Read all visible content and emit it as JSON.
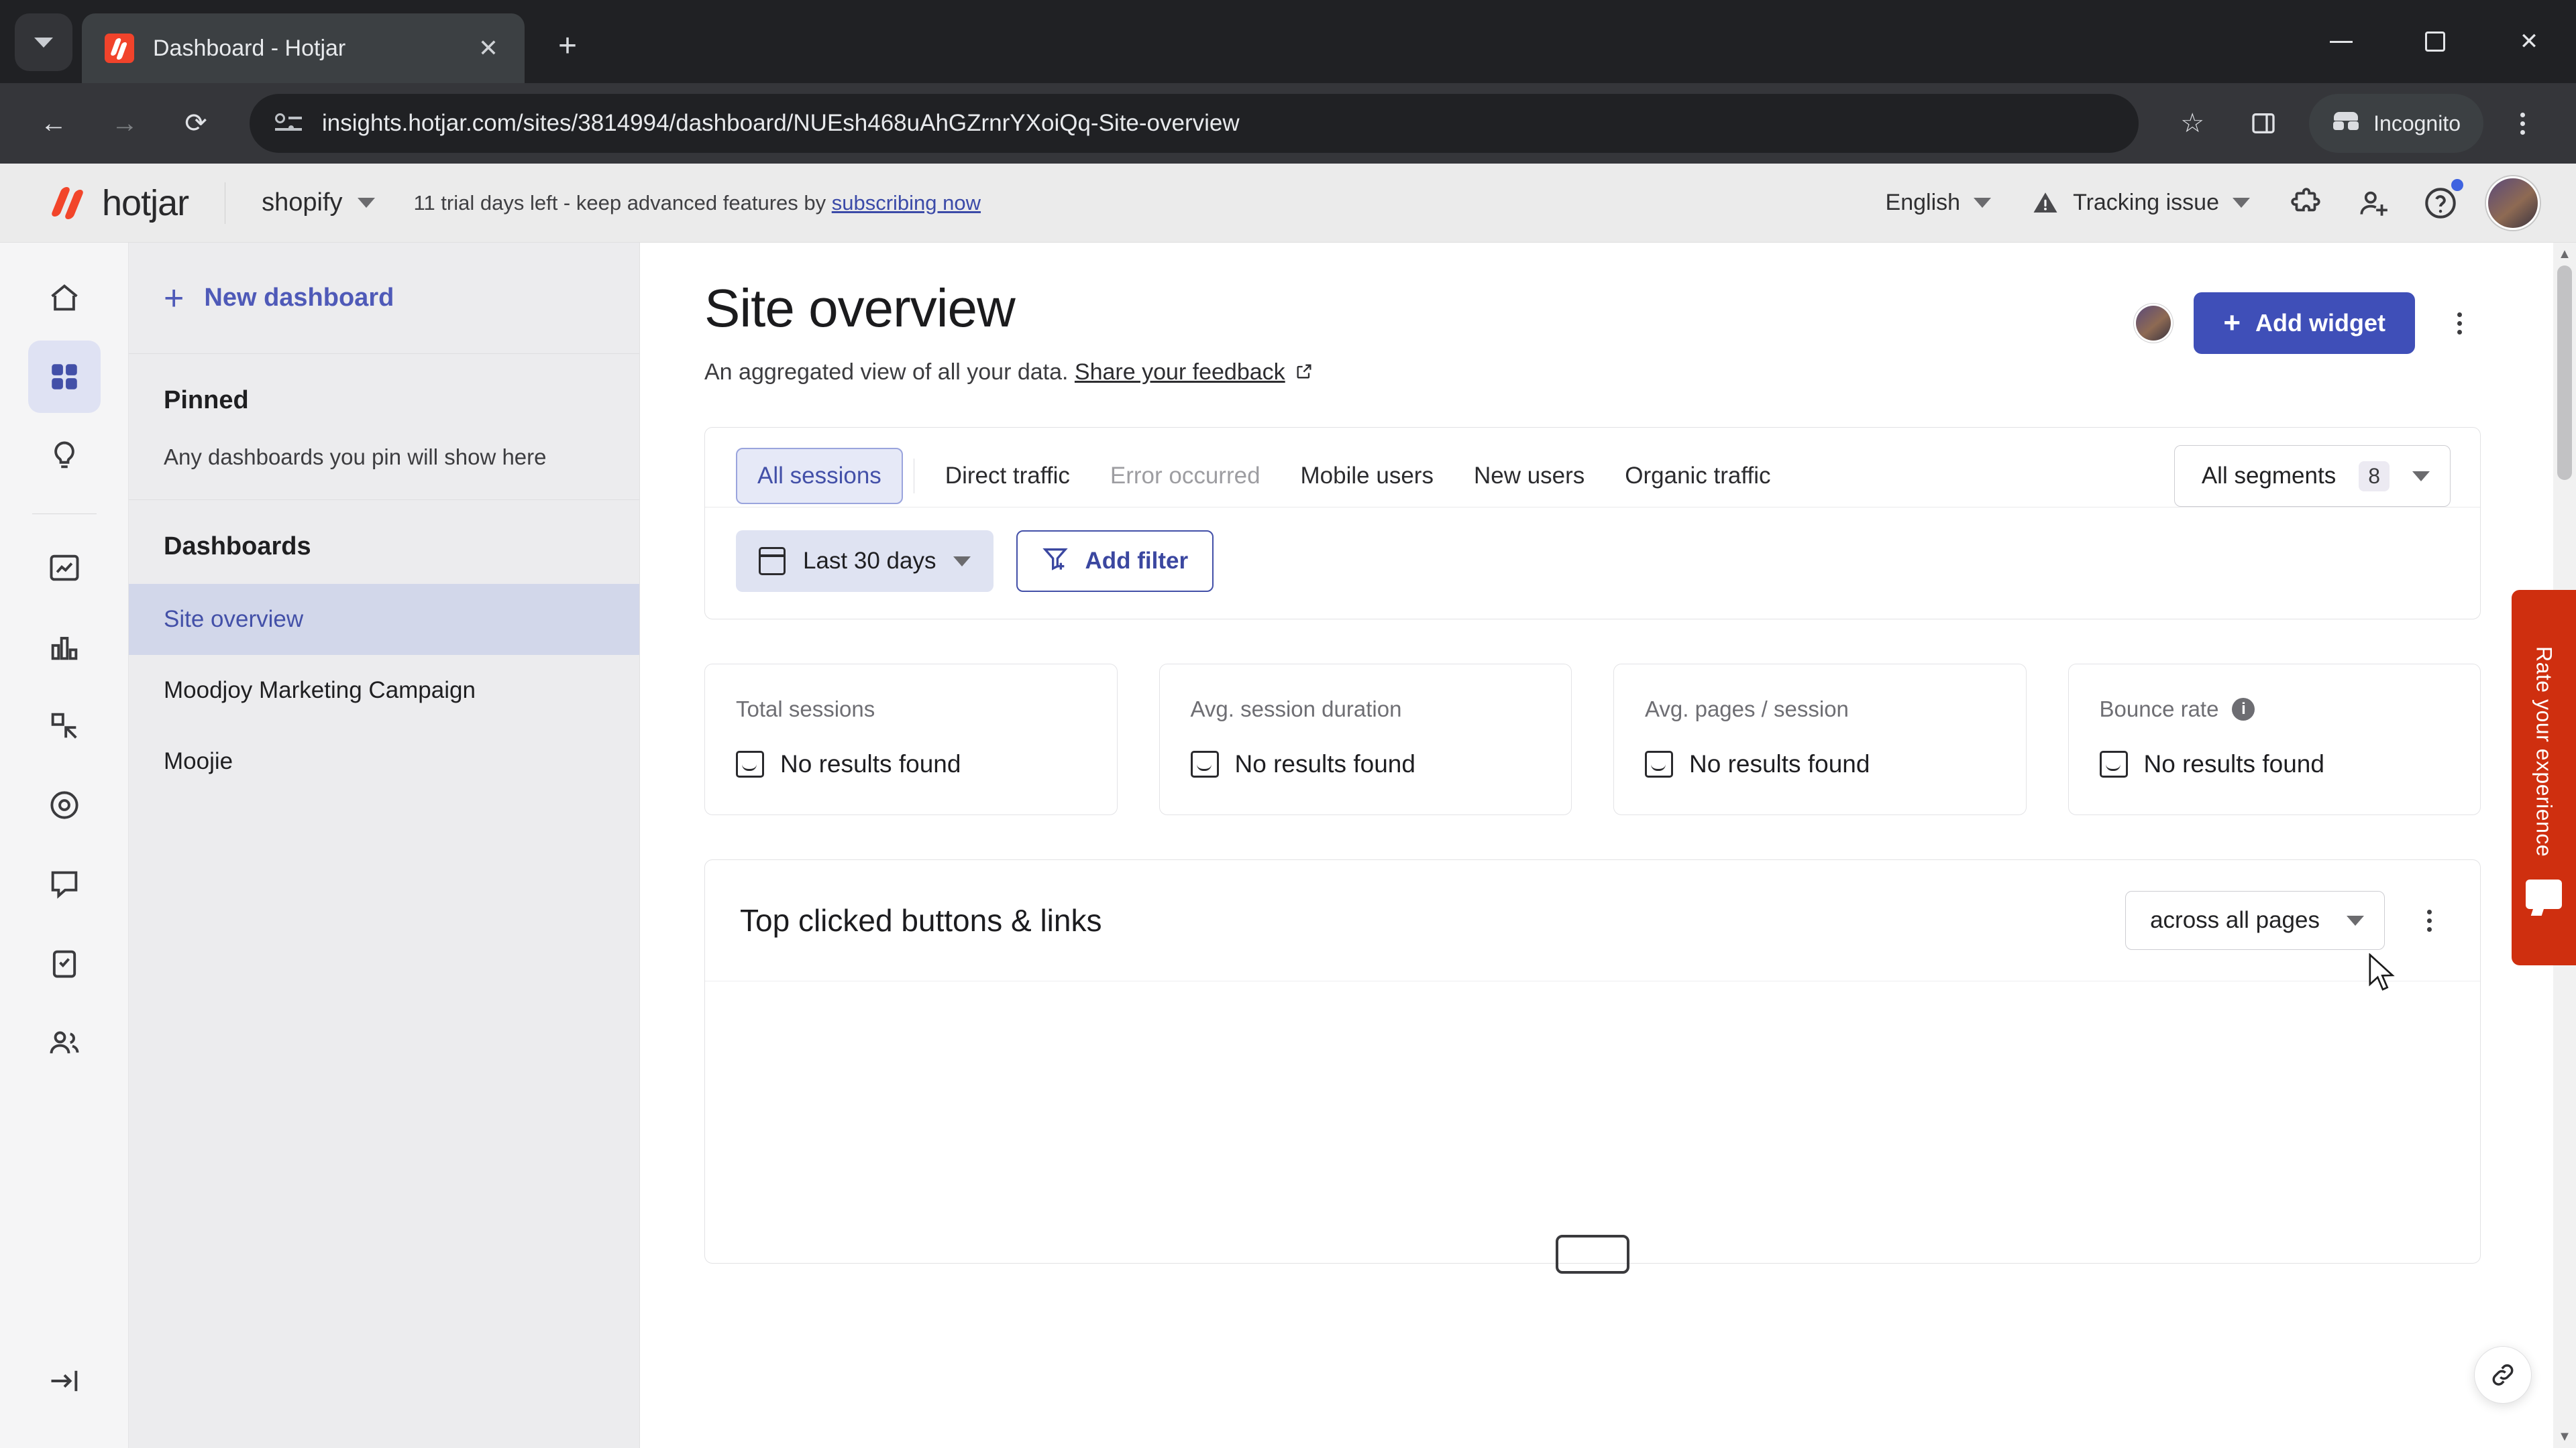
{
  "browser": {
    "tab": {
      "title": "Dashboard - Hotjar",
      "favicon_icon": "hotjar-favicon",
      "close_icon": "close-icon"
    },
    "tab_list_icon": "chevron-down-icon",
    "new_tab_icon": "plus-icon",
    "window": {
      "minimize_icon": "minimize-icon",
      "maximize_icon": "maximize-icon",
      "close_icon": "close-icon"
    },
    "nav": {
      "back_icon": "arrow-back-icon",
      "forward_icon": "arrow-forward-icon",
      "reload_icon": "reload-icon"
    },
    "omnibox": {
      "site_info_icon": "page-info-icon",
      "url": "insights.hotjar.com/sites/3814994/dashboard/NUEsh468uAhGZrnrYXoiQq-Site-overview",
      "bookmark_icon": "star-icon",
      "sidepanel_icon": "side-panel-icon"
    },
    "incognito": {
      "label": "Incognito",
      "icon": "incognito-icon"
    },
    "menu_icon": "kebab-menu-icon"
  },
  "header": {
    "logo_text": "hotjar",
    "logo_icon": "hotjar-logo-icon",
    "site": {
      "label": "shopify",
      "caret_icon": "chevron-down-icon"
    },
    "trial": {
      "text": "11 trial days left - keep advanced features by ",
      "link": "subscribing now"
    },
    "language": {
      "label": "English",
      "caret_icon": "chevron-down-icon"
    },
    "tracking": {
      "label": "Tracking issue",
      "warning_icon": "warning-triangle-icon",
      "caret_icon": "chevron-down-icon"
    },
    "icons": {
      "extensions": "puzzle-piece-icon",
      "invite": "add-user-icon",
      "help": "help-circle-icon"
    },
    "avatar_icon": "user-avatar"
  },
  "rail": {
    "items": [
      {
        "name": "home",
        "icon": "home-icon",
        "active": false
      },
      {
        "name": "dashboards",
        "icon": "dashboard-grid-icon",
        "active": true
      },
      {
        "name": "highlights",
        "icon": "lightbulb-icon",
        "active": false
      },
      {
        "name": "trends",
        "icon": "trends-chart-icon",
        "active": false
      },
      {
        "name": "funnels",
        "icon": "bar-chart-icon",
        "active": false
      },
      {
        "name": "recordings",
        "icon": "recordings-icon",
        "active": false
      },
      {
        "name": "heatmaps",
        "icon": "heatmap-target-icon",
        "active": false
      },
      {
        "name": "feedback",
        "icon": "chat-bubble-icon",
        "active": false
      },
      {
        "name": "surveys",
        "icon": "clipboard-check-icon",
        "active": false
      },
      {
        "name": "users",
        "icon": "users-icon",
        "active": false
      }
    ],
    "collapse_icon": "collapse-arrow-icon"
  },
  "dashboards_panel": {
    "new_dashboard": {
      "label": "New dashboard",
      "icon": "plus-icon"
    },
    "pinned": {
      "heading": "Pinned",
      "empty_note": "Any dashboards you pin will show here"
    },
    "dashboards": {
      "heading": "Dashboards",
      "items": [
        {
          "label": "Site overview",
          "active": true
        },
        {
          "label": "Moodjoy Marketing Campaign",
          "active": false
        },
        {
          "label": "Moojie",
          "active": false
        }
      ]
    }
  },
  "main": {
    "title": "Site overview",
    "subtitle_prefix": "An aggregated view of all your data. ",
    "subtitle_link": "Share your feedback",
    "external_link_icon": "external-link-icon",
    "add_widget": {
      "label": "Add widget",
      "icon": "plus-icon"
    },
    "more_icon": "kebab-menu-icon",
    "avatar_icon": "user-avatar",
    "segment_tabs": [
      {
        "label": "All sessions",
        "state": "active"
      },
      {
        "label": "Direct traffic",
        "state": "normal"
      },
      {
        "label": "Error occurred",
        "state": "muted"
      },
      {
        "label": "Mobile users",
        "state": "normal"
      },
      {
        "label": "New users",
        "state": "normal"
      },
      {
        "label": "Organic traffic",
        "state": "normal"
      }
    ],
    "segments_select": {
      "label": "All segments",
      "count": "8",
      "caret_icon": "chevron-down-icon"
    },
    "date_filter": {
      "label": "Last 30 days",
      "icon": "calendar-icon",
      "caret_icon": "chevron-down-icon"
    },
    "add_filter": {
      "label": "Add filter",
      "icon": "filter-add-icon"
    },
    "metrics": [
      {
        "label": "Total sessions",
        "value": "No results found",
        "value_icon": "no-results-icon",
        "has_info": false
      },
      {
        "label": "Avg. session duration",
        "value": "No results found",
        "value_icon": "no-results-icon",
        "has_info": false
      },
      {
        "label": "Avg. pages / session",
        "value": "No results found",
        "value_icon": "no-results-icon",
        "has_info": false
      },
      {
        "label": "Bounce rate",
        "value": "No results found",
        "value_icon": "no-results-icon",
        "has_info": true,
        "info_icon": "info-icon",
        "info_glyph": "i"
      }
    ],
    "widget": {
      "title": "Top clicked buttons & links",
      "scope_select": {
        "label": "across all pages",
        "caret_icon": "chevron-down-icon"
      },
      "more_icon": "kebab-menu-icon"
    }
  },
  "rate_experience": {
    "label": "Rate your experience",
    "icon": "feedback-card-icon"
  },
  "link_fab_icon": "link-chain-icon",
  "scrollbar": {
    "up_icon": "scroll-up-icon",
    "down_icon": "scroll-down-icon"
  },
  "colors": {
    "accent": "#3f4fb8",
    "hotjar_red": "#f2452a",
    "rate_tab_red": "#cf2f0f",
    "active_tab_bg": "#e6e9f7",
    "sidebar_active": "#d2d7ea"
  }
}
